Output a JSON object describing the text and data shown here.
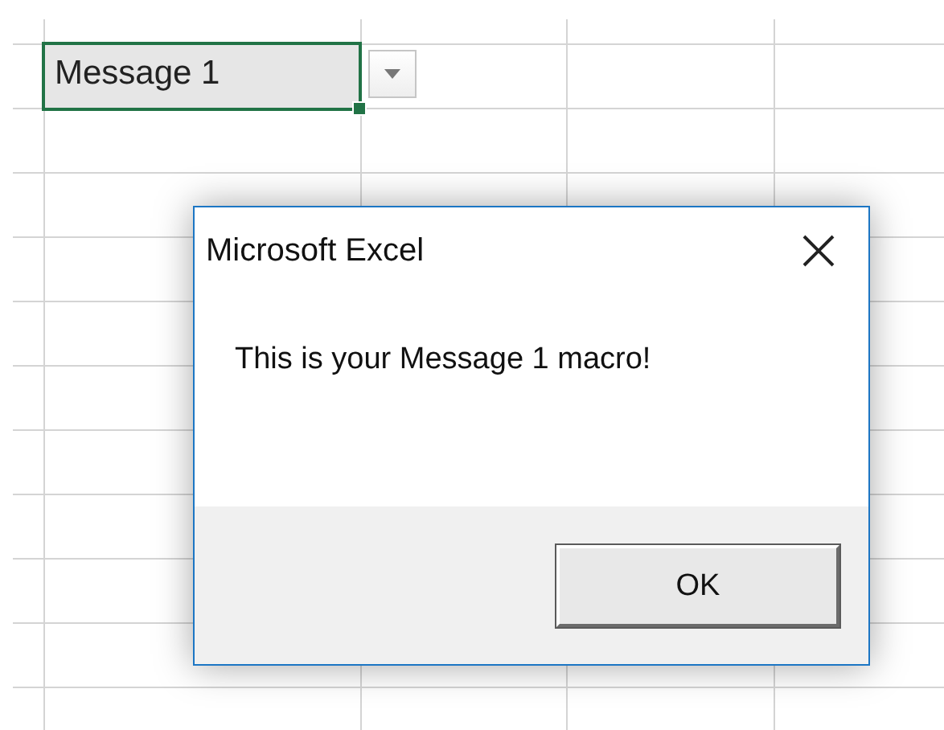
{
  "sheet": {
    "active_cell": {
      "value": "Message 1"
    }
  },
  "dialog": {
    "title": "Microsoft Excel",
    "message": "This is your Message 1 macro!",
    "buttons": [
      "OK"
    ]
  }
}
